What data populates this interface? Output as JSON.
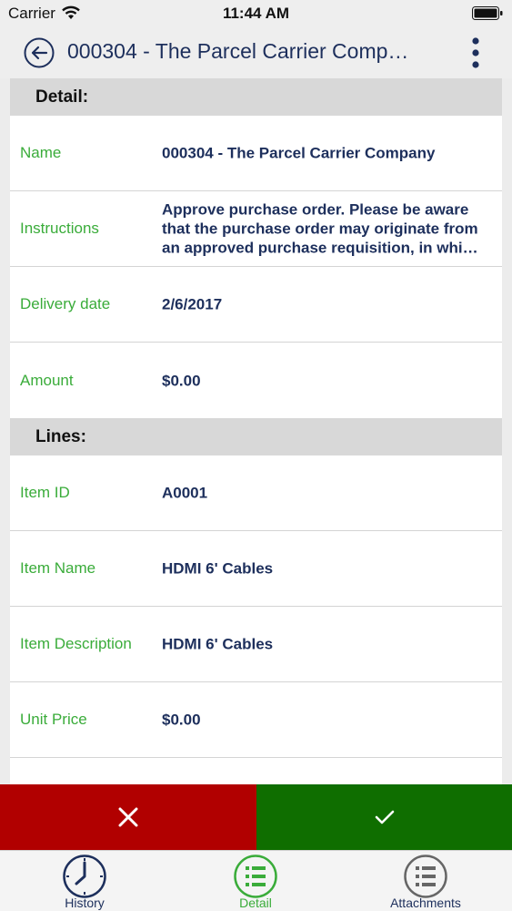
{
  "status_bar": {
    "carrier": "Carrier",
    "time": "11:44 AM"
  },
  "nav": {
    "title": "000304 - The Parcel Carrier Comp…"
  },
  "detail": {
    "header": "Detail:",
    "rows": [
      {
        "label": "Name",
        "value": "000304 - The Parcel Carrier Company"
      },
      {
        "label": "Instructions",
        "value_lines": [
          "Approve purchase order. Please be aware",
          "that the purchase order may originate from",
          "an approved purchase requisition, in whi…"
        ]
      },
      {
        "label": "Delivery date",
        "value": "2/6/2017"
      },
      {
        "label": "Amount",
        "value": "$0.00"
      }
    ]
  },
  "lines": {
    "header": "Lines:",
    "rows": [
      {
        "label": "Item ID",
        "value": "A0001"
      },
      {
        "label": "Item Name",
        "value": "HDMI 6' Cables"
      },
      {
        "label": "Item Description",
        "value": "HDMI 6' Cables"
      },
      {
        "label": "Unit Price",
        "value": "$0.00"
      }
    ]
  },
  "tabs": [
    {
      "label": "History",
      "icon": "clock-icon",
      "color": "#1d2f5c"
    },
    {
      "label": "Detail",
      "icon": "list-icon",
      "color": "#3aac3a"
    },
    {
      "label": "Attachments",
      "icon": "list-icon",
      "color": "#1d2f5c"
    }
  ],
  "colors": {
    "reject": "#b10000",
    "approve": "#0f6e00",
    "label": "#3aac3a",
    "value": "#1d2f5c"
  }
}
